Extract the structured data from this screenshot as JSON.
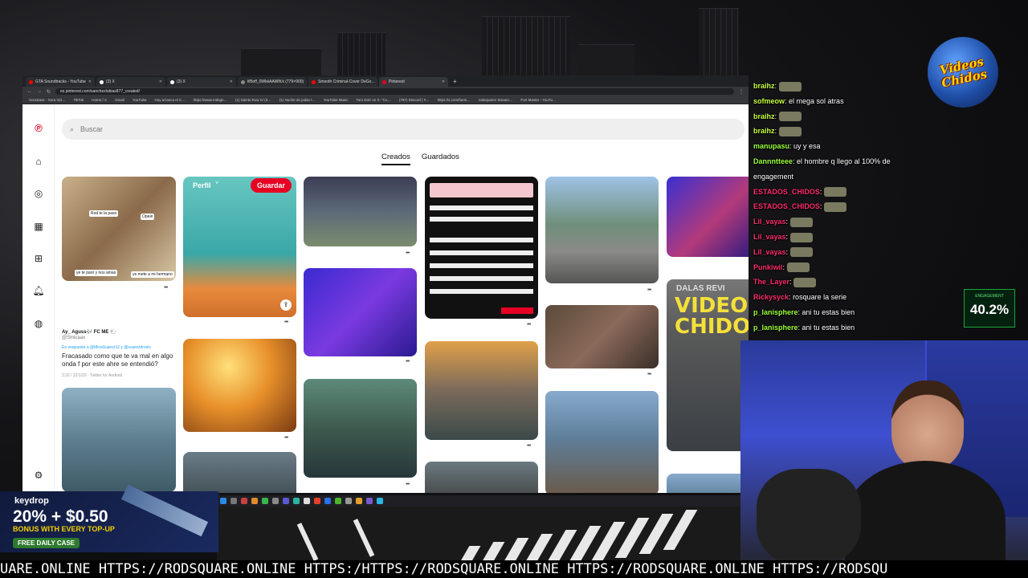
{
  "browser": {
    "tabs": [
      {
        "label": "GTA Soundtracks - YouTube",
        "color": "#ff0000",
        "active": false
      },
      {
        "label": "(3) X",
        "color": "#ffffff",
        "active": false
      },
      {
        "label": "(3) X",
        "color": "#ffffff",
        "active": false
      },
      {
        "label": "lif5off_0WkkAAWlfi.k (779×900)",
        "color": "#888888",
        "active": false
      },
      {
        "label": "Smooth Criminal-Cover DeGo…",
        "color": "#ff0000",
        "active": false
      },
      {
        "label": "Pinterest",
        "color": "#e60023",
        "active": true
      }
    ],
    "new_tab": "+",
    "url": "es.pinterest.com/sanchezlubias877_created/",
    "bookmarks": [
      "SoraSave - Sora Vid…",
      "TikTok",
      "Home / X",
      "Gmail",
      "YouTube",
      "Hoy arranca el C…",
      "https://www.mdsgn…",
      "(1) Saints Row IV (2…",
      "(1) Noche de jodas t…",
      "YouTube Music",
      "Tom Dörr on X: \"Co…",
      "(787) Discord | #…",
      "https://x.com/fueni…",
      "rodsquarez Stream…",
      "Fort Master - YouTu…"
    ]
  },
  "pinterest": {
    "search_placeholder": "Buscar",
    "tabs": [
      "Creados",
      "Guardados"
    ],
    "perfil_label": "Perfil",
    "save_label": "Guardar",
    "pin_labels": {
      "comic1_a": "Rod te la paso",
      "comic1_b": "Opeei",
      "comic1_c": "ye te paro y nos amas",
      "comic1_d": "ye mete a mi hermano"
    },
    "tweet": {
      "author": "Ay_ Aguss🎶 FC ME 🐑",
      "handle": "@Smlcaax",
      "reply": "En respuesta a @MicaSuarez12 y @suarezdronic",
      "text": "Fracasado como que te va mal en algo onda f por este ahre se entendió?",
      "meta": "3:32 / 22/1/20 · Twitter for Android"
    }
  },
  "chat": [
    {
      "user": "braihz",
      "msg": "",
      "emote": true,
      "style": "u"
    },
    {
      "user": "sofmeow",
      "msg": "el mega sol atras",
      "emote": false,
      "style": "u"
    },
    {
      "user": "braihz",
      "msg": "",
      "emote": true,
      "style": "u"
    },
    {
      "user": "braihz",
      "msg": "",
      "emote": true,
      "style": "u"
    },
    {
      "user": "manupasu",
      "msg": "uy y esa",
      "emote": false,
      "style": "u3"
    },
    {
      "user": "Dannntteee",
      "msg": "el hombre q llego al 100% de engagement",
      "emote": false,
      "style": "u3"
    },
    {
      "user": "ESTADOS_CHIDOS",
      "msg": "",
      "emote": true,
      "style": "u2"
    },
    {
      "user": "ESTADOS_CHIDOS",
      "msg": "",
      "emote": true,
      "style": "u2"
    },
    {
      "user": "Lil_vayas",
      "msg": "",
      "emote": true,
      "style": "u2"
    },
    {
      "user": "Lil_vayas",
      "msg": "",
      "emote": true,
      "style": "u2"
    },
    {
      "user": "Lil_vayas",
      "msg": "",
      "emote": true,
      "style": "u2"
    },
    {
      "user": "Punkiwii",
      "msg": "",
      "emote": true,
      "style": "u2"
    },
    {
      "user": "The_Layer",
      "msg": "",
      "emote": true,
      "style": "u2"
    },
    {
      "user": "Rickysyck",
      "msg": "rosquare la serie",
      "emote": false,
      "style": "u2"
    },
    {
      "user": "p_lanisphere",
      "msg": "ani tu estas bien",
      "emote": false,
      "style": "u3"
    },
    {
      "user": "p_lanisphere",
      "msg": "ani tu estas bien",
      "emote": false,
      "style": "u3"
    }
  ],
  "engagement": {
    "title": "ENGAGEMENT",
    "value": "40.2%"
  },
  "logo": {
    "text": "Videos Chidos"
  },
  "dalas": {
    "line1": "DALAS REVI",
    "line2": "VIDEO",
    "line3": "CHIDOS"
  },
  "ad": {
    "brand": "keydrop",
    "headline": "20% + $0.50",
    "sub": "BONUS WITH EVERY TOP-UP",
    "cta": "FREE DAILY CASE"
  },
  "ticker": "UARE.ONLINE HTTPS://RODSQUARE.ONLINE HTTPS:/HTTPS://RODSQUARE.ONLINE HTTPS://RODSQUARE.ONLINE HTTPS://RODSQU"
}
